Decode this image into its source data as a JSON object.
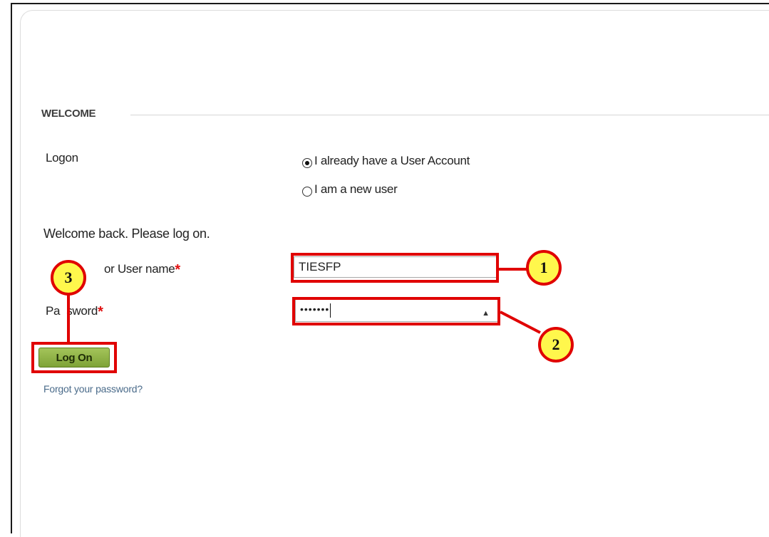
{
  "section": {
    "heading": "WELCOME"
  },
  "logon": {
    "label": "Logon",
    "options": [
      {
        "label": "I already have a User Account",
        "selected": true
      },
      {
        "label": "I am a new user",
        "selected": false
      }
    ]
  },
  "form": {
    "intro": "Welcome back. Please log on.",
    "username_label": "or User name",
    "username_label_partial_prefix": "",
    "username_value": "TIESFP",
    "password_label_start": "Pa",
    "password_label_end": "sword",
    "password_mask": "•••••••",
    "required_marker": "*",
    "logon_button": "Log On",
    "forgot_link": "Forgot your password?"
  },
  "annotations": {
    "callouts": [
      "1",
      "2",
      "3"
    ],
    "highlight_color": "#e00000",
    "callout_fill": "#fff74c"
  },
  "colors": {
    "button": "#8db544",
    "required": "#e01010",
    "link": "#4a6b8a"
  }
}
